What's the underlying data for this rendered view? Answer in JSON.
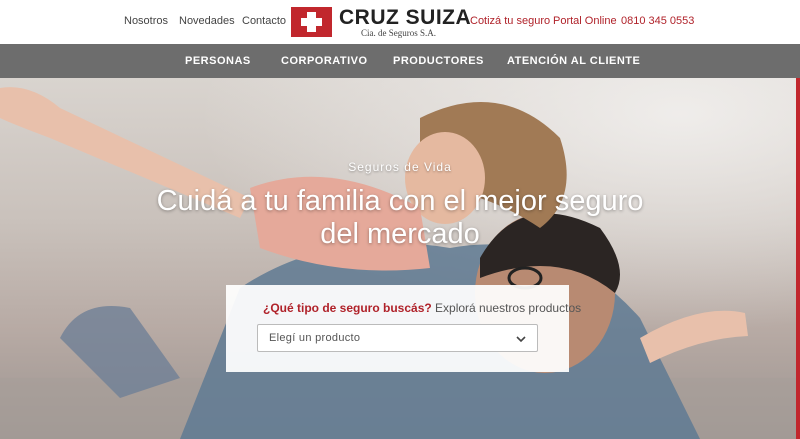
{
  "header": {
    "nav_left": [
      "Nosotros",
      "Novedades",
      "Contacto"
    ],
    "logo": {
      "name": "CRUZ SUIZA",
      "subtitle": "Cia. de Seguros S.A."
    },
    "nav_right": [
      "Cotizá tu seguro",
      "Portal Online",
      "0810 345 0553"
    ]
  },
  "main_nav": [
    "PERSONAS",
    "CORPORATIVO",
    "PRODUCTORES",
    "ATENCIÓN AL CLIENTE"
  ],
  "hero": {
    "kicker": "Seguros de Vida",
    "headline": "Cuidá a tu familia con el mejor seguro del mercado",
    "search": {
      "question": "¿Qué tipo de seguro buscás?",
      "question_rest": " Explorá nuestros productos",
      "select_value": "Elegí un producto"
    }
  },
  "colors": {
    "brand_red": "#c1272d",
    "nav_gray": "#6d6d6d"
  },
  "icons": {
    "select_arrow": "chevron-down-icon",
    "logo_mark": "swiss-cross-icon"
  }
}
